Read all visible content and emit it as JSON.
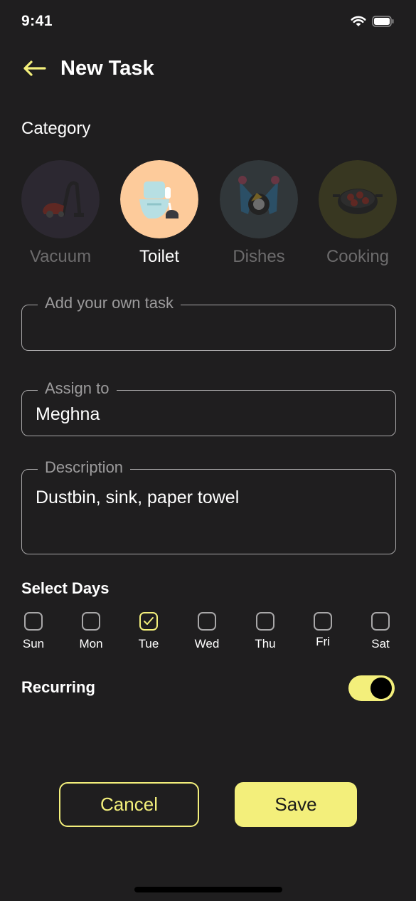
{
  "status_bar": {
    "time": "9:41",
    "icons": [
      "wifi-icon",
      "battery-icon"
    ]
  },
  "header": {
    "title": "New Task",
    "back_icon": "arrow-left-icon"
  },
  "category": {
    "label": "Category",
    "items": [
      {
        "name": "Vacuum",
        "selected": false
      },
      {
        "name": "Toilet",
        "selected": true
      },
      {
        "name": "Dishes",
        "selected": false
      },
      {
        "name": "Cooking",
        "selected": false
      }
    ]
  },
  "fields": {
    "task": {
      "label": "Add your own task",
      "value": ""
    },
    "assign": {
      "label": "Assign to",
      "value": "Meghna"
    },
    "description": {
      "label": "Description",
      "value": "Dustbin, sink, paper towel"
    }
  },
  "days": {
    "label": "Select Days",
    "items": [
      {
        "name": "Sun",
        "checked": false
      },
      {
        "name": "Mon",
        "checked": false
      },
      {
        "name": "Tue",
        "checked": true
      },
      {
        "name": "Wed",
        "checked": false
      },
      {
        "name": "Thu",
        "checked": false
      },
      {
        "name": "Fri",
        "checked": false
      },
      {
        "name": "Sat",
        "checked": false
      }
    ]
  },
  "recurring": {
    "label": "Recurring",
    "on": true
  },
  "actions": {
    "cancel": "Cancel",
    "save": "Save"
  },
  "colors": {
    "background": "#1f1e1f",
    "accent": "#f3ef7b",
    "border": "#a8a7a8",
    "muted": "#6c6b6c"
  }
}
